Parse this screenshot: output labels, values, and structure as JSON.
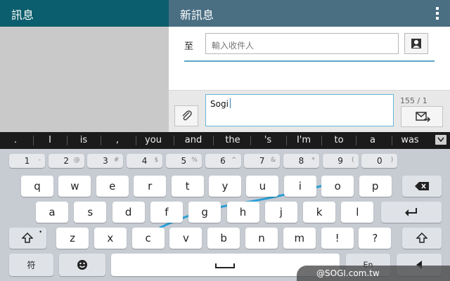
{
  "left_pane": {
    "title": "訊息"
  },
  "right_pane": {
    "title": "新訊息",
    "to_label": "至",
    "recipient_placeholder": "輸入收件人",
    "message_text": "Sogi",
    "char_count": "155 / 1"
  },
  "suggestions": [
    ".",
    "I",
    "is",
    ",",
    "you",
    "and",
    "the",
    "'s",
    "I'm",
    "to",
    "a",
    "was"
  ],
  "keyboard": {
    "number_row": [
      {
        "main": "1",
        "sub": "-"
      },
      {
        "main": "2",
        "sub": "@"
      },
      {
        "main": "3",
        "sub": "#"
      },
      {
        "main": "4",
        "sub": "$"
      },
      {
        "main": "5",
        "sub": "%"
      },
      {
        "main": "6",
        "sub": "^"
      },
      {
        "main": "7",
        "sub": "&"
      },
      {
        "main": "8",
        "sub": "*"
      },
      {
        "main": "9",
        "sub": "("
      },
      {
        "main": "0",
        "sub": ")"
      }
    ],
    "row1": [
      "q",
      "w",
      "e",
      "r",
      "t",
      "y",
      "u",
      "i",
      "o",
      "p"
    ],
    "row2": [
      "a",
      "s",
      "d",
      "f",
      "g",
      "h",
      "j",
      "k",
      "l"
    ],
    "row3": [
      {
        "main": "z",
        "sub": ""
      },
      {
        "main": "x",
        "sub": ""
      },
      {
        "main": "c",
        "sub": ""
      },
      {
        "main": "v",
        "sub": ""
      },
      {
        "main": "b",
        "sub": ""
      },
      {
        "main": "n",
        "sub": ""
      },
      {
        "main": "m",
        "sub": ""
      },
      {
        "main": "!",
        "sub": "!"
      },
      {
        "main": "?",
        "sub": "?"
      }
    ],
    "symbol_key": "符",
    "language_key": "En"
  },
  "watermark": "@SOGI.com.tw",
  "colors": {
    "left_header": "#0b5e6d",
    "right_header": "#4a6f83",
    "accent": "#5aa7c9",
    "trace": "#2a9fd6"
  }
}
